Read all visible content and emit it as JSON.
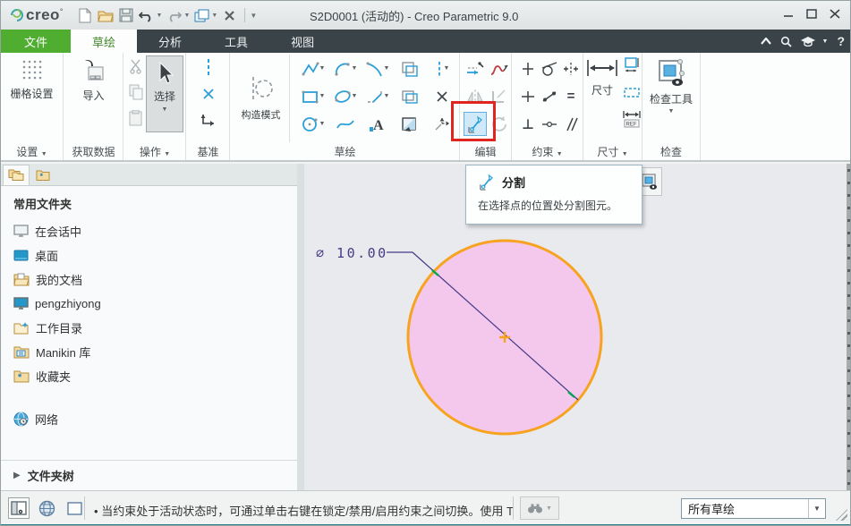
{
  "titlebar": {
    "logo_text": "creo",
    "logo_deg": "°",
    "title": "S2D0001 (活动的) - Creo Parametric 9.0"
  },
  "window_controls": {
    "minimize": "–",
    "maximize": "❒",
    "close": "×"
  },
  "tabs": {
    "file": "文件",
    "sketch": "草绘",
    "analysis": "分析",
    "tools": "工具",
    "view": "视图"
  },
  "tabbar_right": {
    "help": "?"
  },
  "ribbon": {
    "settings": {
      "button": "栅格设置",
      "label": "设置"
    },
    "get_data": {
      "button": "导入",
      "label": "获取数据"
    },
    "operations": {
      "button": "选择",
      "label": "操作"
    },
    "datum": {
      "label": "基准"
    },
    "sketch": {
      "construction": "构造模式",
      "label": "草绘"
    },
    "edit": {
      "label": "编辑"
    },
    "constrain": {
      "label": "约束",
      "equal": "=",
      "perpendicular": "⊥"
    },
    "dimension": {
      "button": "尺寸",
      "ref": "REF",
      "label": "尺寸"
    },
    "inspect": {
      "button": "检查工具",
      "label": "检查"
    },
    "text_tool_glyph": "A"
  },
  "tooltip": {
    "title": "分割",
    "description": "在选择点的位置处分割图元。"
  },
  "sidebar": {
    "header": "常用文件夹",
    "items": [
      "在会话中",
      "桌面",
      "我的文档",
      "pengzhiyong",
      "工作目录",
      "Manikin 库",
      "收藏夹",
      "网络"
    ],
    "folder_tree": "文件夹树",
    "folder_tree_arrow": "▶"
  },
  "canvas": {
    "dimension_label": "∅ 10.00"
  },
  "statusbar": {
    "bullet": "•",
    "message": "当约束处于活动状态时，可通过单击右键在锁定/禁用/启用约束之间切换。使用 T",
    "filter_value": "所有草绘"
  },
  "colors": {
    "accent_green": "#4fae2f",
    "tab_dark": "#3a4347",
    "highlight_red": "#e0251f",
    "circle_stroke": "#f7a320",
    "circle_fill": "#f3c8ec",
    "dimension_color": "#453a86",
    "divide_highlight": "#cfe9f8"
  }
}
